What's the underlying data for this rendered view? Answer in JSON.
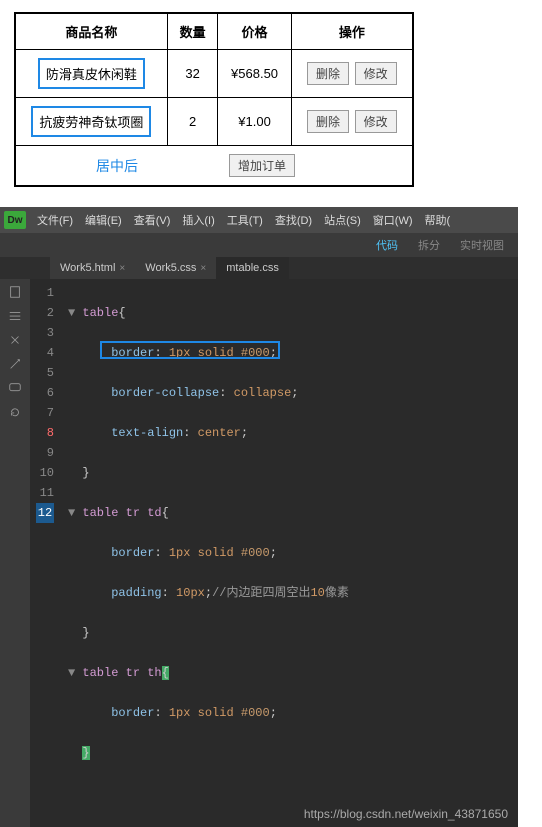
{
  "table": {
    "headers": [
      "商品名称",
      "数量",
      "价格",
      "操作"
    ],
    "rows": [
      {
        "name": "防滑真皮休闲鞋",
        "qty": "32",
        "price": "¥568.50"
      },
      {
        "name": "抗疲劳神奇钛项圈",
        "qty": "2",
        "price": "¥1.00"
      }
    ],
    "delete_label": "删除",
    "edit_label": "修改",
    "center_label": "居中后",
    "add_order_label": "增加订单"
  },
  "ide": {
    "logo": "Dw",
    "menu": [
      "文件(F)",
      "编辑(E)",
      "查看(V)",
      "插入(I)",
      "工具(T)",
      "查找(D)",
      "站点(S)",
      "窗口(W)",
      "帮助("
    ],
    "subbar": {
      "code": "代码",
      "split": "拆分",
      "live": "实时视图"
    },
    "tabs": [
      {
        "label": "Work5.html",
        "active": false
      },
      {
        "label": "Work5.css",
        "active": false
      },
      {
        "label": "mtable.css",
        "active": true
      }
    ],
    "code_lines": [
      {
        "n": "1",
        "sel": "table",
        "brace": "{"
      },
      {
        "n": "2",
        "prop": "border",
        "val_num": "1px",
        "val_kw": "solid",
        "val_hex": "#000"
      },
      {
        "n": "3",
        "prop": "border-collapse",
        "val_kw": "collapse"
      },
      {
        "n": "4",
        "prop": "text-align",
        "val_kw": "center"
      },
      {
        "n": "5",
        "brace": "}"
      },
      {
        "n": "6",
        "sel": "table tr td",
        "brace": "{"
      },
      {
        "n": "7",
        "prop": "border",
        "val_num": "1px",
        "val_kw": "solid",
        "val_hex": "#000"
      },
      {
        "n": "8",
        "err": true,
        "prop": "padding",
        "val_num": "10px",
        "com_pre": "//内边距四周空出",
        "com_num": "10",
        "com_post": "像素"
      },
      {
        "n": "9",
        "brace": "}"
      },
      {
        "n": "10",
        "sel": "table tr th",
        "brace": "{"
      },
      {
        "n": "11",
        "prop": "border",
        "val_num": "1px",
        "val_kw": "solid",
        "val_hex": "#000"
      },
      {
        "n": "12",
        "sel_line": true,
        "brace": "}"
      }
    ],
    "watermark": "https://blog.csdn.net/weixin_43871650"
  }
}
